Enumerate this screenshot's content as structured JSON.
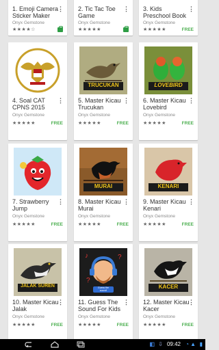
{
  "cards": [
    {
      "number": "1.",
      "title": "Emoji Camera Sticker Maker",
      "developer": "Onyx Gemstone",
      "rating": "★★★★☆",
      "price": "",
      "owned": true
    },
    {
      "number": "2.",
      "title": "Tic Tac Toe Game",
      "developer": "Onyx Gemstone",
      "rating": "★★★★★",
      "price": "",
      "owned": true
    },
    {
      "number": "3.",
      "title": "Kids Preschool Book",
      "developer": "Onyx Gemstone",
      "rating": "★★★★★",
      "price": "FREE",
      "owned": false
    },
    {
      "number": "4.",
      "title": "Soal CAT CPNS 2015",
      "developer": "Onyx Gemstone",
      "rating": "★★★★★",
      "price": "FREE"
    },
    {
      "number": "5.",
      "title": "Master Kicau Trucukan",
      "developer": "Onyx Gemstone",
      "rating": "★★★★★",
      "price": "FREE",
      "image_text": "TRUCUKAN"
    },
    {
      "number": "6.",
      "title": "Master Kicau Lovebird",
      "developer": "Onyx Gemstone",
      "rating": "★★★★★",
      "price": "FREE",
      "image_text": "LOVEBIRD"
    },
    {
      "number": "7.",
      "title": "Strawberry Jump",
      "developer": "Onyx Gemstone",
      "rating": "★★★★★",
      "price": "FREE"
    },
    {
      "number": "8.",
      "title": "Master Kicau Murai",
      "developer": "Onyx Gemstone",
      "rating": "★★★★★",
      "price": "FREE",
      "image_text": "MURAI"
    },
    {
      "number": "9.",
      "title": "Master Kicau Kenari",
      "developer": "Onyx Gemstone",
      "rating": "★★★★★",
      "price": "FREE",
      "image_text": "KENARI"
    },
    {
      "number": "10.",
      "title": "Master Kicau Jalak",
      "developer": "Onyx Gemstone",
      "rating": "★★★★★",
      "price": "FREE",
      "image_text": "JALAK SUREN"
    },
    {
      "number": "11.",
      "title": "Guess The Sound For Kids",
      "developer": "Onyx Gemstone",
      "rating": "★★★★★",
      "price": "FREE",
      "image_text": "Guess the sound!"
    },
    {
      "number": "12.",
      "title": "Master Kicau Kacer",
      "developer": "Onyx Gemstone",
      "rating": "★★★★★",
      "price": "FREE",
      "image_text": "KACER"
    }
  ],
  "status_bar": {
    "time": "09:42",
    "icons": [
      "back-icon",
      "home-icon",
      "recents-icon",
      "wifi-icon",
      "signal-icon",
      "battery-icon"
    ]
  },
  "colors": {
    "free_green": "#4caf50",
    "owned_green": "#2e9e45",
    "background": "#e6e6e6"
  }
}
